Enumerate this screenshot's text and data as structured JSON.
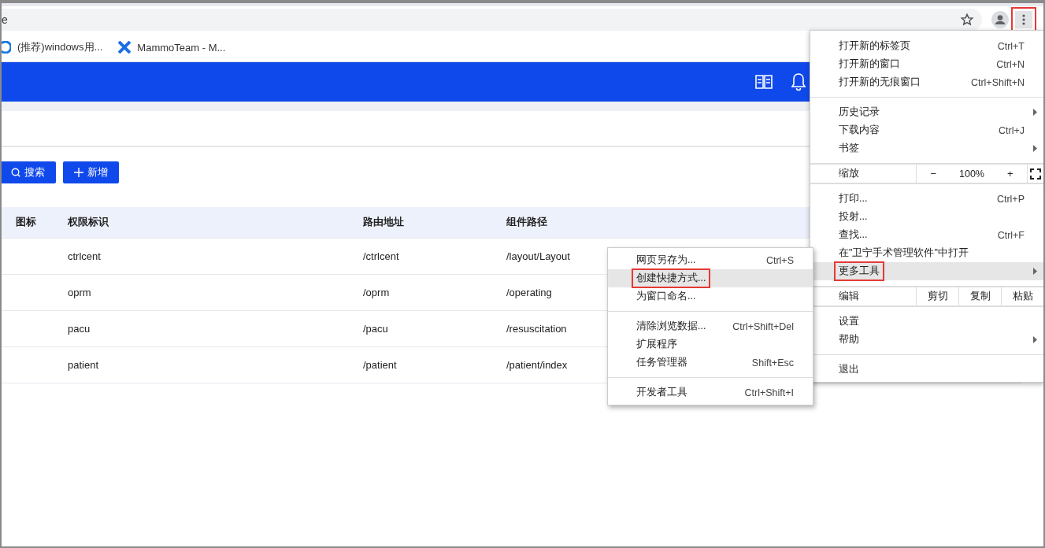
{
  "address_bar": {
    "url": "e",
    "menu_outlined": true
  },
  "bookmarks": [
    {
      "label": "(推荐)windows用..."
    },
    {
      "label": "MammoTeam - M..."
    }
  ],
  "toolbar": {
    "search_button": "搜索",
    "add_button": "新增"
  },
  "table": {
    "columns": [
      "图标",
      "权限标识",
      "路由地址",
      "组件路径"
    ],
    "rows": [
      {
        "permission": "ctrlcent",
        "route": "/ctrlcent",
        "component": "/layout/Layout"
      },
      {
        "permission": "oprm",
        "route": "/oprm",
        "component": "/operating"
      },
      {
        "permission": "pacu",
        "route": "/pacu",
        "component": "/resuscitation"
      },
      {
        "permission": "patient",
        "route": "/patient",
        "component": "/patient/index"
      }
    ]
  },
  "menu": {
    "sections": [
      [
        {
          "kind": "item",
          "label": "打开新的标签页",
          "shortcut": "Ctrl+T",
          "submenu": false,
          "selected": false,
          "outlined": false
        },
        {
          "kind": "item",
          "label": "打开新的窗口",
          "shortcut": "Ctrl+N",
          "submenu": false,
          "selected": false,
          "outlined": false
        },
        {
          "kind": "item",
          "label": "打开新的无痕窗口",
          "shortcut": "Ctrl+Shift+N",
          "submenu": false,
          "selected": false,
          "outlined": false
        }
      ],
      [
        {
          "kind": "item",
          "label": "历史记录",
          "submenu": true,
          "selected": false,
          "outlined": false
        },
        {
          "kind": "item",
          "label": "下载内容",
          "shortcut": "Ctrl+J",
          "submenu": false,
          "selected": false,
          "outlined": false
        },
        {
          "kind": "item",
          "label": "书签",
          "submenu": true,
          "selected": false,
          "outlined": false
        }
      ],
      [
        {
          "kind": "zoom",
          "label": "缩放",
          "minus": "−",
          "value": "100%",
          "plus": "+"
        }
      ],
      [
        {
          "kind": "item",
          "label": "打印...",
          "shortcut": "Ctrl+P",
          "submenu": false,
          "selected": false,
          "outlined": false
        },
        {
          "kind": "item",
          "label": "投射...",
          "submenu": false,
          "selected": false,
          "outlined": false
        },
        {
          "kind": "item",
          "label": "查找...",
          "shortcut": "Ctrl+F",
          "submenu": false,
          "selected": false,
          "outlined": false
        },
        {
          "kind": "item",
          "label": "在\"卫宁手术管理软件\"中打开",
          "submenu": false,
          "selected": false,
          "outlined": false
        },
        {
          "kind": "item",
          "label": "更多工具",
          "submenu": true,
          "selected": true,
          "outlined": true
        }
      ],
      [
        {
          "kind": "edit",
          "label": "编辑",
          "buttons": [
            "剪切",
            "复制",
            "粘贴"
          ]
        }
      ],
      [
        {
          "kind": "item",
          "label": "设置",
          "submenu": false,
          "selected": false,
          "outlined": false
        },
        {
          "kind": "item",
          "label": "帮助",
          "submenu": true,
          "selected": false,
          "outlined": false
        }
      ],
      [
        {
          "kind": "item",
          "label": "退出",
          "submenu": false,
          "selected": false,
          "outlined": false
        }
      ]
    ]
  },
  "submenu": {
    "sections": [
      [
        {
          "label": "网页另存为...",
          "shortcut": "Ctrl+S",
          "selected": false,
          "outlined": false
        },
        {
          "label": "创建快捷方式...",
          "selected": true,
          "outlined": true
        },
        {
          "label": "为窗口命名...",
          "selected": false,
          "outlined": false
        }
      ],
      [
        {
          "label": "清除浏览数据...",
          "shortcut": "Ctrl+Shift+Del",
          "selected": false,
          "outlined": false
        },
        {
          "label": "扩展程序",
          "selected": false,
          "outlined": false
        },
        {
          "label": "任务管理器",
          "shortcut": "Shift+Esc",
          "selected": false,
          "outlined": false
        }
      ],
      [
        {
          "label": "开发者工具",
          "shortcut": "Ctrl+Shift+I",
          "selected": false,
          "outlined": false
        }
      ]
    ]
  }
}
